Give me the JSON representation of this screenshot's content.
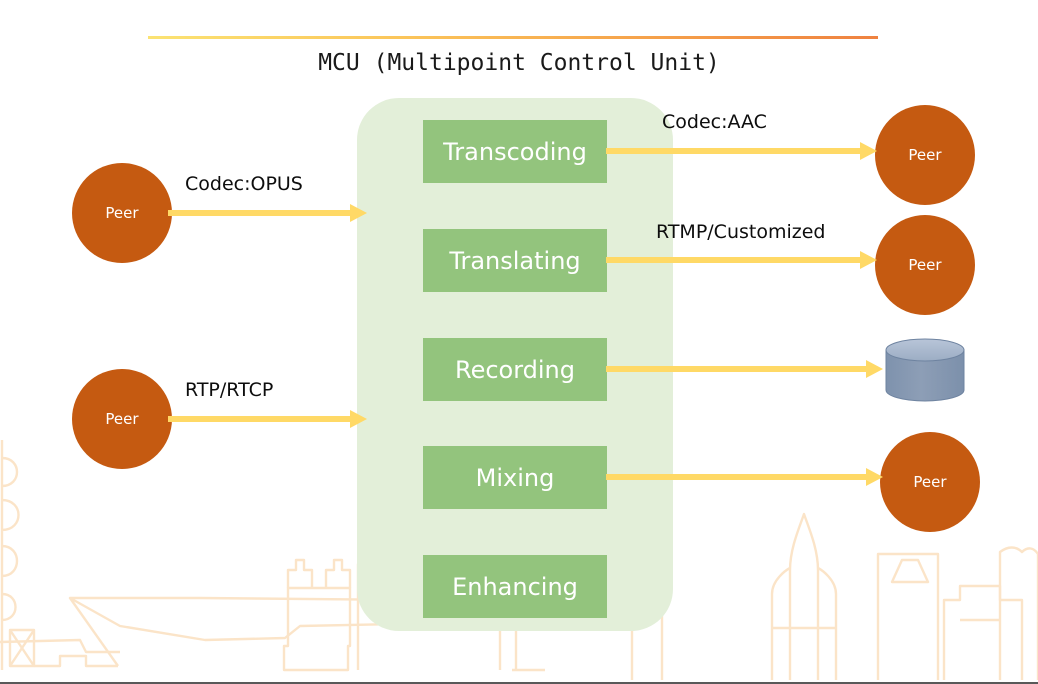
{
  "slide": {
    "title": "MCU (Multipoint Control Unit)",
    "background_color": "#ffffff",
    "accent_gradient_from": "#fbe373",
    "accent_gradient_to": "#ef8240",
    "bottom_border_color": "#595959"
  },
  "mcu": {
    "container_color": "#e3efd9",
    "box_color": "#93c47d",
    "box_text_color": "#ffffff",
    "functions": [
      {
        "label": "Transcoding"
      },
      {
        "label": "Translating"
      },
      {
        "label": "Recording"
      },
      {
        "label": "Mixing"
      },
      {
        "label": "Enhancing"
      }
    ]
  },
  "nodes": {
    "peer_color": "#c55a11",
    "peer_text_color": "#ffffff",
    "database_color": "#8497b0",
    "database_top_color": "#a9b8cd",
    "inputs": [
      {
        "label": "Peer"
      },
      {
        "label": "Peer"
      }
    ],
    "outputs": [
      {
        "label": "Peer"
      },
      {
        "label": "Peer"
      },
      {
        "label": "Peer"
      }
    ],
    "storage": {
      "name": "database-cylinder"
    }
  },
  "edges": {
    "arrow_color": "#ffd966",
    "incoming": [
      {
        "label": "Codec:OPUS",
        "from": "peer-in-1",
        "to": "mcu"
      },
      {
        "label": "RTP/RTCP",
        "from": "peer-in-2",
        "to": "mcu"
      }
    ],
    "outgoing": [
      {
        "label": "Codec:AAC",
        "from": "Transcoding",
        "to": "peer-out-1"
      },
      {
        "label": "RTMP/Customized",
        "from": "Translating",
        "to": "peer-out-2"
      },
      {
        "label": "",
        "from": "Recording",
        "to": "database"
      },
      {
        "label": "",
        "from": "Mixing",
        "to": "peer-out-3"
      }
    ]
  },
  "decoration": {
    "skyline_color": "#fbe4c8",
    "skyline_name": "city-skyline-watermark"
  }
}
